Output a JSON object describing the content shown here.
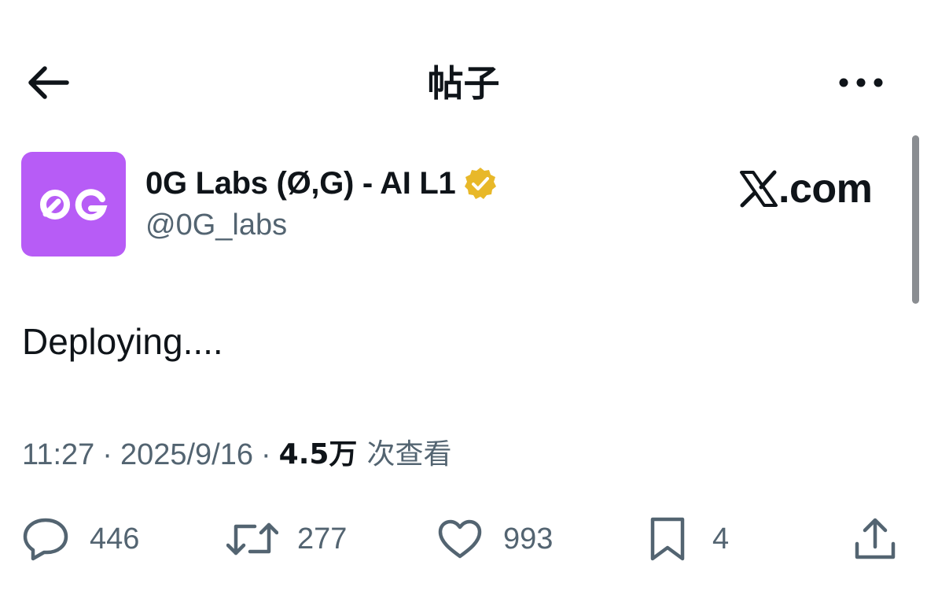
{
  "header": {
    "title": "帖子",
    "back_icon": "arrow-left-icon",
    "more_icon": "more-horizontal-icon"
  },
  "author": {
    "display_name": "0G Labs (Ø,G) - AI L1",
    "handle": "@0G_labs",
    "avatar_text": "0G",
    "avatar_color": "#b75cf6",
    "verified_badge_color": "#e8b829"
  },
  "watermark": {
    "text": ".com",
    "logo_icon": "x-logo-icon"
  },
  "tweet": {
    "text": "Deploying...."
  },
  "meta": {
    "time": "11:27",
    "separator": "·",
    "date": "2025/9/16",
    "views_count": "4.5万",
    "views_label": "次查看"
  },
  "actions": {
    "reply_count": "446",
    "retweet_count": "277",
    "like_count": "993",
    "bookmark_count": "4"
  },
  "colors": {
    "text_primary": "#0f1419",
    "text_secondary": "#536471",
    "icon_gray": "#536471"
  }
}
